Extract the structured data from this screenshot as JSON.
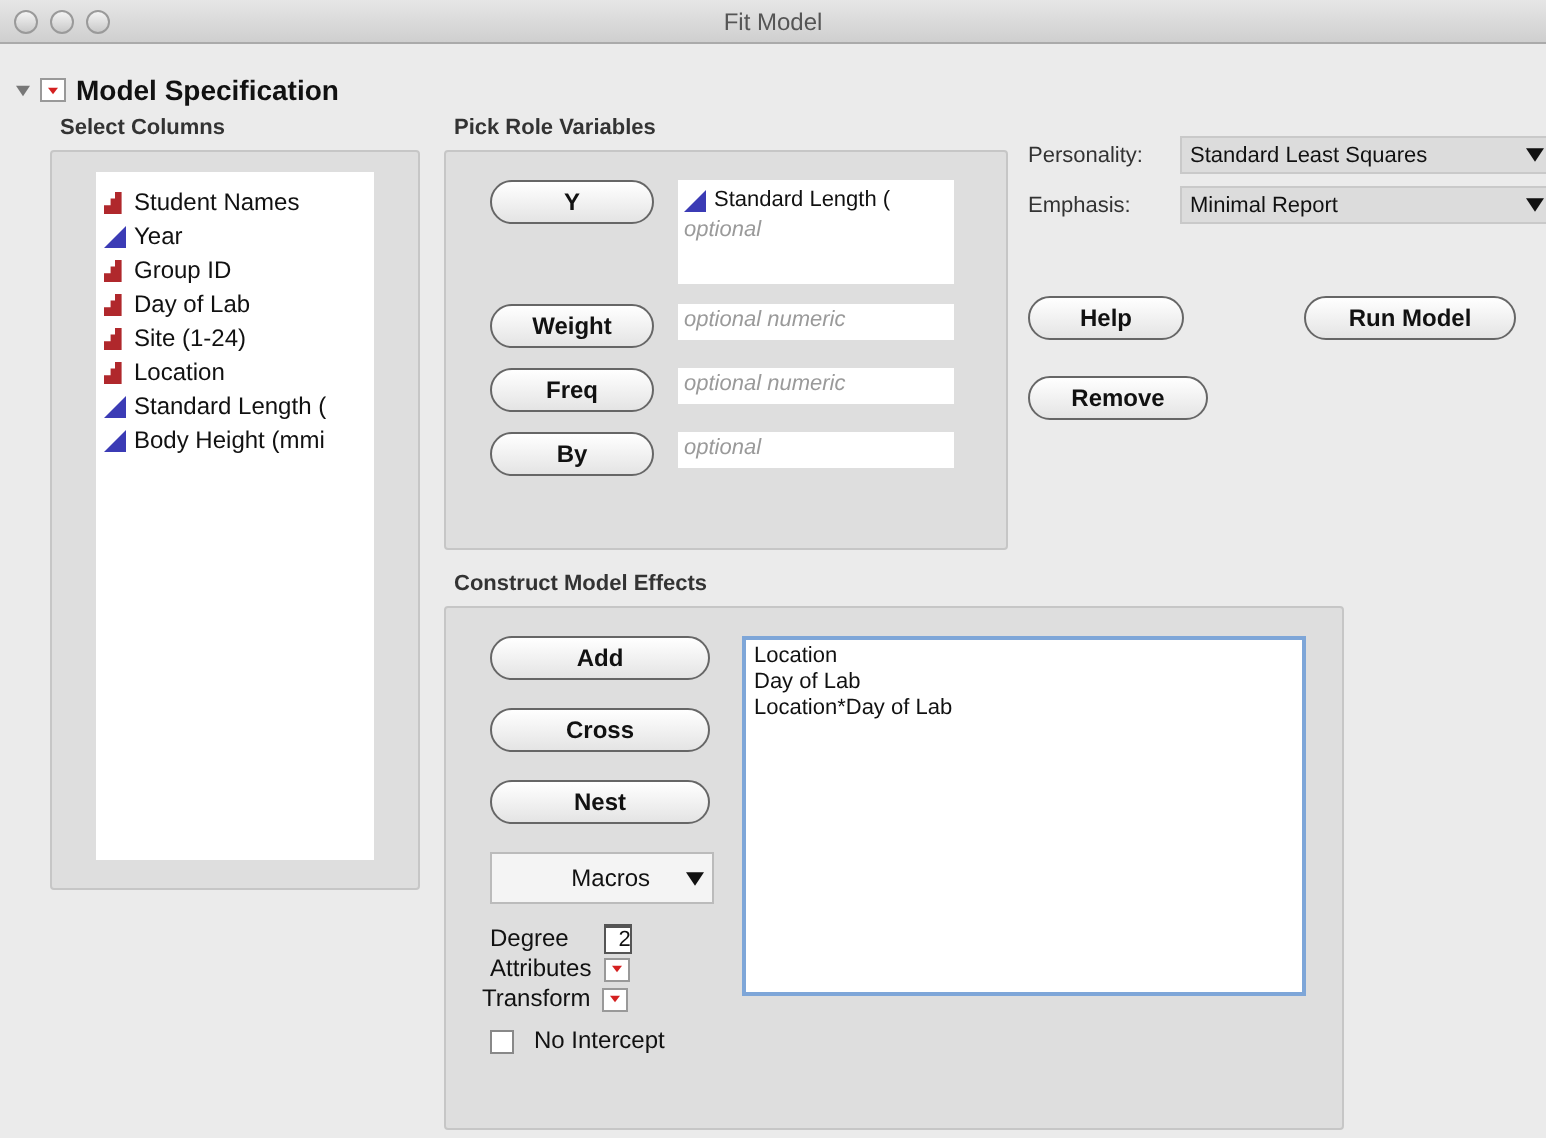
{
  "window": {
    "title": "Fit Model"
  },
  "section": {
    "title": "Model Specification",
    "expanded": true
  },
  "select_columns": {
    "title": "Select Columns",
    "items": [
      {
        "label": "Student Names",
        "kind": "nominal"
      },
      {
        "label": "Year",
        "kind": "continuous"
      },
      {
        "label": "Group ID",
        "kind": "nominal"
      },
      {
        "label": "Day of Lab",
        "kind": "nominal"
      },
      {
        "label": "Site (1-24)",
        "kind": "nominal"
      },
      {
        "label": "Location",
        "kind": "nominal"
      },
      {
        "label": "Standard Length (",
        "kind": "continuous"
      },
      {
        "label": "Body Height (mmi",
        "kind": "continuous"
      }
    ]
  },
  "pick_role": {
    "title": "Pick Role Variables",
    "roles": [
      {
        "button": "Y",
        "items": [
          {
            "label": "Standard Length (",
            "kind": "continuous"
          }
        ],
        "placeholder": "optional"
      },
      {
        "button": "Weight",
        "placeholder": "optional numeric"
      },
      {
        "button": "Freq",
        "placeholder": "optional numeric"
      },
      {
        "button": "By",
        "placeholder": "optional"
      }
    ]
  },
  "personality": {
    "label": "Personality:",
    "value": "Standard Least Squares"
  },
  "emphasis": {
    "label": "Emphasis:",
    "value": "Minimal Report"
  },
  "buttons": {
    "help": "Help",
    "run": "Run Model",
    "remove": "Remove"
  },
  "construct": {
    "title": "Construct Model Effects",
    "buttons": [
      "Add",
      "Cross",
      "Nest"
    ],
    "macros": "Macros",
    "degree_label": "Degree",
    "degree": "2",
    "attributes": "Attributes",
    "transform": "Transform",
    "no_intercept": {
      "label": "No Intercept",
      "checked": false
    },
    "effects": [
      "Location",
      "Day of Lab",
      "Location*Day of Lab"
    ]
  }
}
